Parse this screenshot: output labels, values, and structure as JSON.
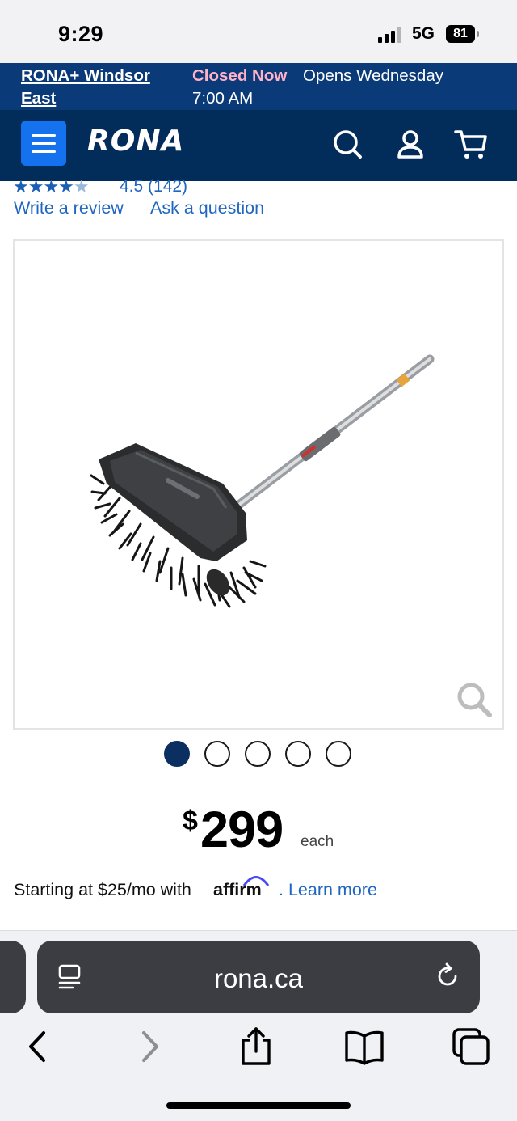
{
  "status": {
    "time": "9:29",
    "network": "5G",
    "battery": "81"
  },
  "store": {
    "name": "RONA+ Windsor East",
    "status": "Closed Now",
    "opens_label": "Opens Wednesday",
    "opens_time": "7:00 AM"
  },
  "nav": {
    "logo": "RONA"
  },
  "product": {
    "rating": 4.5,
    "rating_text": "4.5 (142)",
    "write_review": "Write a review",
    "ask_question": "Ask a question",
    "image_count": 5,
    "active_image": 1,
    "price_currency": "$",
    "price_value": "299",
    "price_unit": "each",
    "financing_prefix": "Starting at $25/mo with",
    "financing_brand": "affirm",
    "financing_suffix": ".",
    "learn_more": "Learn more"
  },
  "browser": {
    "url": "rona.ca"
  },
  "colors": {
    "store_bar": "#0a3a78",
    "nav_bar": "#022d5b",
    "menu_button": "#1572ee",
    "link": "#1f66c1",
    "closed_status": "#ffb1c8"
  }
}
